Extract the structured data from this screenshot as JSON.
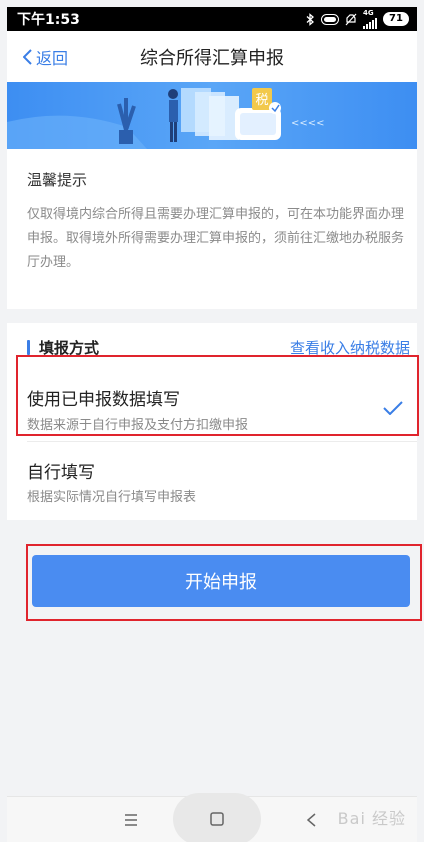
{
  "statusbar": {
    "time": "下午1:53",
    "network": "4G",
    "battery": "71"
  },
  "navbar": {
    "back_label": "返回",
    "title": "综合所得汇算申报"
  },
  "banner": {
    "tax_char": "税",
    "arrows": "<<<<"
  },
  "tips": {
    "title": "温馨提示",
    "text": "仅取得境内综合所得且需要办理汇算申报的，可在本功能界面办理申报。取得境外所得需要办理汇算申报的，须前往汇缴地办税服务厅办理。"
  },
  "method": {
    "title": "填报方式",
    "link": "查看收入纳税数据",
    "options": [
      {
        "title": "使用已申报数据填写",
        "subtitle": "数据来源于自行申报及支付方扣缴申报",
        "selected": true
      },
      {
        "title": "自行填写",
        "subtitle": "根据实际情况自行填写申报表",
        "selected": false
      }
    ]
  },
  "start_button": "开始申报",
  "watermark": "Bai 经验",
  "colors": {
    "accent": "#3a7ee6",
    "button": "#4a8cf1",
    "highlight": "#e0242d"
  }
}
